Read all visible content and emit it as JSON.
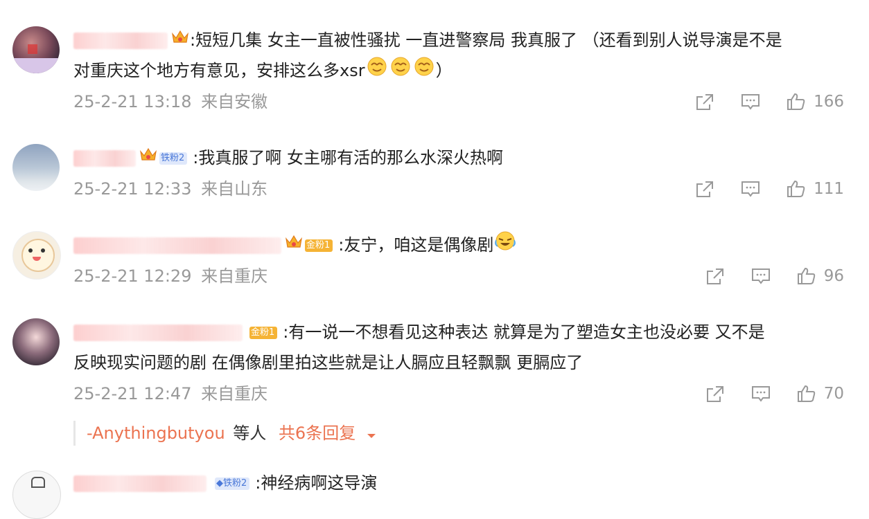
{
  "comments": [
    {
      "text_line1": ":短短几集 女主一直被性骚扰 一直进警察局 我真服了 （还看到别人说导演是不是",
      "text_line2": "对重庆这个地方有意见，安排这么多xsr",
      "text_line2_end": "）",
      "timestamp": "25-2-21 13:18",
      "location": "来自安徽",
      "likes": "166"
    },
    {
      "badge": "铁粉2",
      "text_line1": ":我真服了啊 女主哪有活的那么水深火热啊",
      "timestamp": "25-2-21 12:33",
      "location": "来自山东",
      "likes": "111"
    },
    {
      "badge": "金粉1",
      "text_line1": ":友宁，咱这是偶像剧",
      "timestamp": "25-2-21 12:29",
      "location": "来自重庆",
      "likes": "96"
    },
    {
      "badge": "金粉1",
      "text_line1": ":有一说一不想看见这种表达 就算是为了塑造女主也没必要 又不是",
      "text_line2": "反映现实问题的剧 在偶像剧里拍这些就是让人膈应且轻飘飘 更膈应了",
      "timestamp": "25-2-21 12:47",
      "location": "来自重庆",
      "likes": "70",
      "replies": {
        "user": "-Anythingbutyou",
        "others": "等人",
        "count_label": "共6条回复"
      }
    },
    {
      "badge": "铁粉2",
      "text_line1": ":神经病啊这导演"
    }
  ],
  "icons": {
    "share": "share-icon",
    "comment": "comment-icon",
    "like": "thumbs-up-icon",
    "expand": "caret-down-icon",
    "emoji": "smirk-emoji-icon",
    "laugh": "laugh-cry-emoji-icon",
    "crown": "crown-icon"
  },
  "colors": {
    "accent": "#eb7350",
    "meta_gray": "#999999",
    "iron_badge": "#4a78d8",
    "gold_badge": "#f5b335"
  }
}
